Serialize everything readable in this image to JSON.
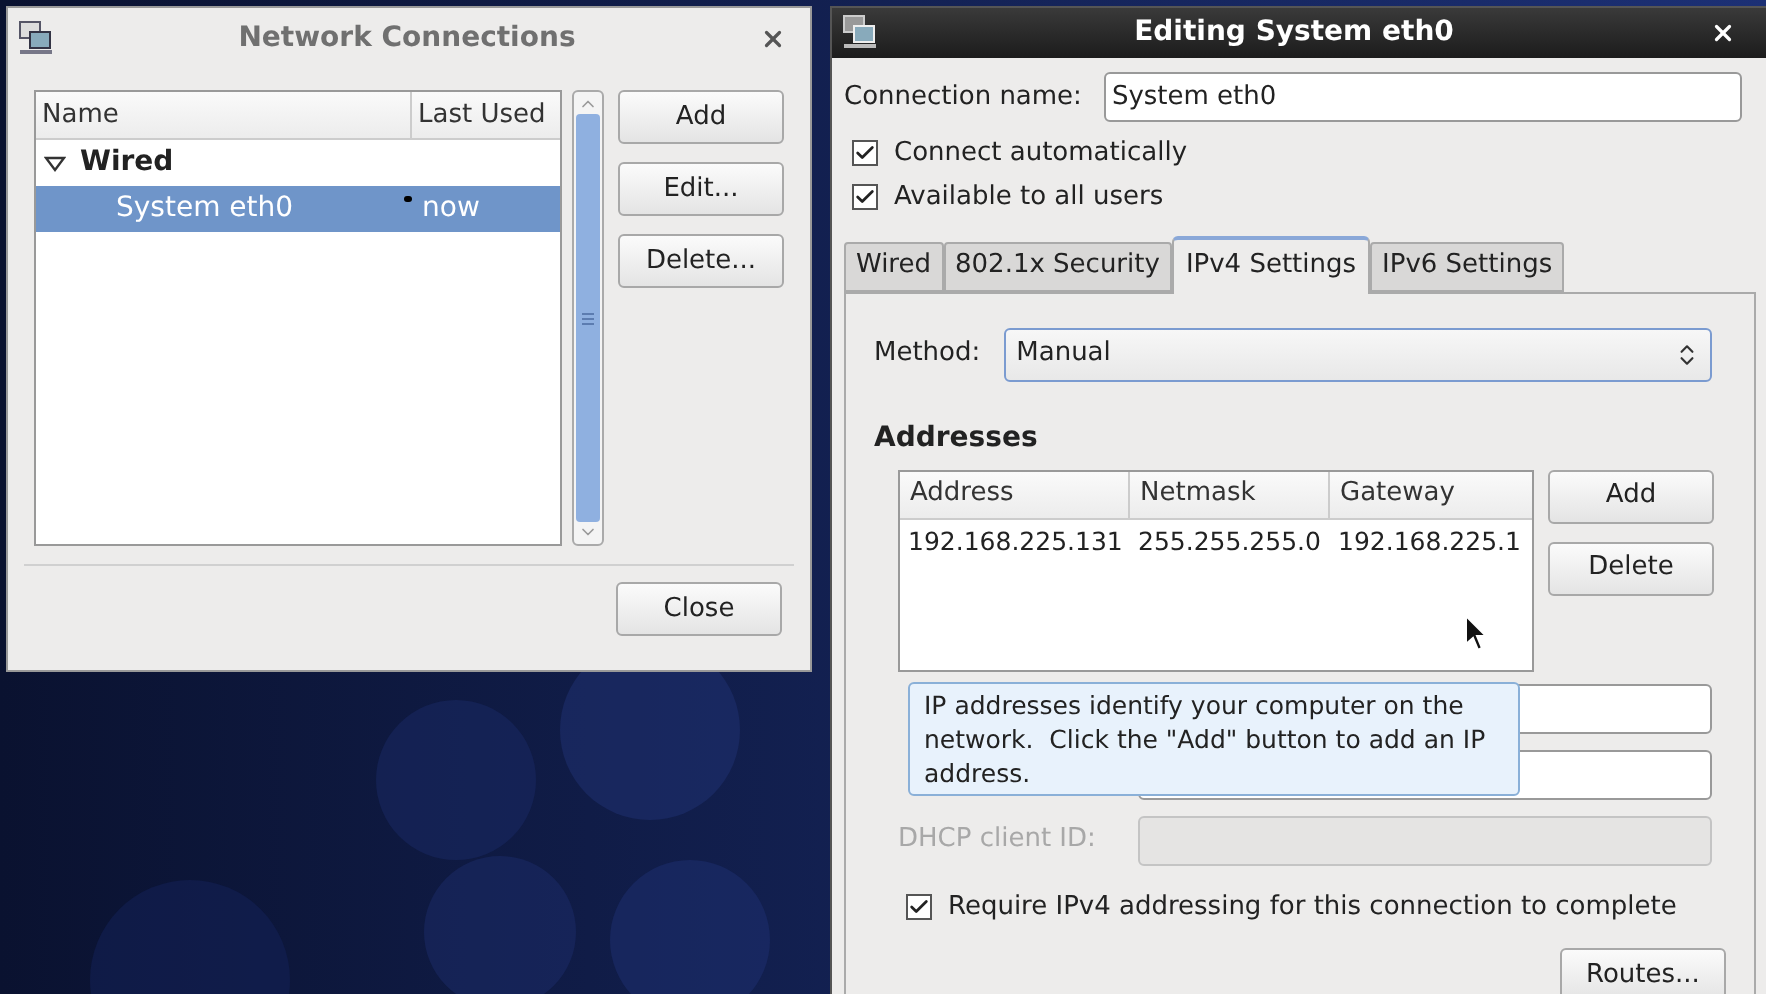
{
  "network_connections": {
    "title": "Network Connections",
    "columns": [
      "Name",
      "Last Used"
    ],
    "groups": [
      {
        "label": "Wired",
        "expanded": true,
        "children": [
          {
            "name": "System eth0",
            "last_used": "now",
            "selected": true
          }
        ]
      }
    ],
    "buttons": [
      "Add",
      "Edit...",
      "Delete..."
    ],
    "close_button": "Close"
  },
  "editor": {
    "title": "Editing System eth0",
    "connection_name_label": "Connection name:",
    "connection_name": "System eth0",
    "checkboxes": [
      {
        "label": "Connect automatically",
        "checked": true
      },
      {
        "label": "Available to all users",
        "checked": true
      }
    ],
    "tabs": [
      {
        "label": "Wired",
        "selected": false
      },
      {
        "label": "802.1x Security",
        "selected": false
      },
      {
        "label": "IPv4 Settings",
        "selected": true
      },
      {
        "label": "IPv6 Settings",
        "selected": false
      }
    ],
    "method_label": "Method:",
    "method": "Manual",
    "addresses_heading": "Addresses",
    "columns": [
      "Address",
      "Netmask",
      "Gateway"
    ],
    "rows": [
      [
        "192.168.225.131",
        "255.255.255.0",
        "192.168.225.1"
      ]
    ],
    "buttons": [
      "Add",
      "Delete"
    ],
    "fields": [
      {
        "disabled": false
      },
      {
        "disabled": false
      },
      {
        "label": "DHCP client ID:",
        "disabled": true
      }
    ],
    "require": {
      "label": "Require IPv4 addressing for this connection to complete",
      "checked": true
    },
    "routes_button": "Routes...",
    "tooltip": "IP addresses identify your computer on the network.  Click the \"Add\" button to add an IP address."
  }
}
